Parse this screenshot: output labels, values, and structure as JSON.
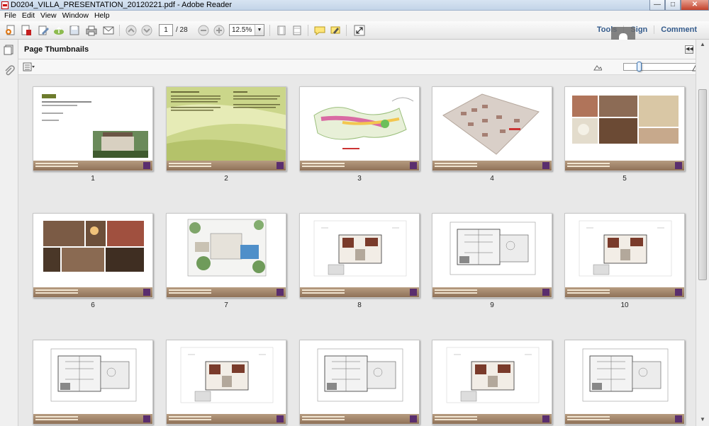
{
  "window": {
    "title": "D0204_VILLA_PRESENTATION_20120221.pdf - Adobe Reader",
    "minimize": "—",
    "maximize": "□",
    "close": "✕"
  },
  "menu": [
    "File",
    "Edit",
    "View",
    "Window",
    "Help"
  ],
  "toolbar": {
    "current_page": "1",
    "total_pages": "/ 28",
    "zoom": "12.5%",
    "links": [
      "Tools",
      "Sign",
      "Comment"
    ]
  },
  "panel": {
    "title": "Page Thumbnails"
  },
  "thumbnail_zoom": 0.18,
  "thumbnails": [
    {
      "label": "1",
      "kind": "cover"
    },
    {
      "label": "2",
      "kind": "text-green"
    },
    {
      "label": "3",
      "kind": "masterplan"
    },
    {
      "label": "4",
      "kind": "aerial"
    },
    {
      "label": "5",
      "kind": "photos"
    },
    {
      "label": "6",
      "kind": "interior"
    },
    {
      "label": "7",
      "kind": "landscape-plan"
    },
    {
      "label": "8",
      "kind": "floor-plan"
    },
    {
      "label": "9",
      "kind": "floor-plan-grey"
    },
    {
      "label": "10",
      "kind": "floor-plan"
    },
    {
      "label": "",
      "kind": "floor-plan-grey"
    },
    {
      "label": "",
      "kind": "floor-plan"
    },
    {
      "label": "",
      "kind": "floor-plan-grey"
    },
    {
      "label": "",
      "kind": "floor-plan"
    },
    {
      "label": "",
      "kind": "floor-plan-grey"
    }
  ]
}
